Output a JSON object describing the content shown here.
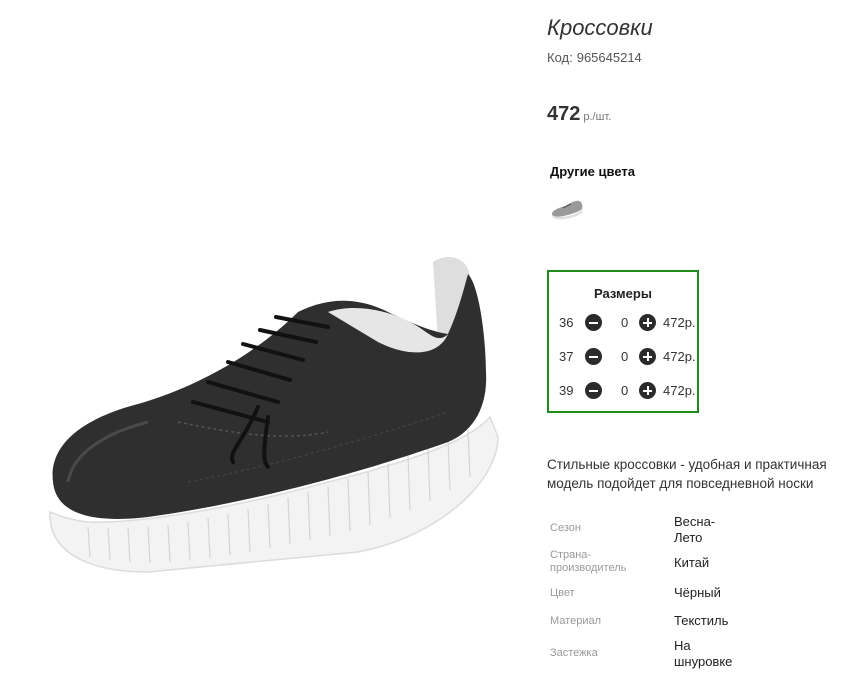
{
  "product": {
    "title": "Кроссовки",
    "code_label": "Код:",
    "code_value": "965645214",
    "price_value": "472",
    "price_unit": "р./шт."
  },
  "other_colors": {
    "title": "Другие цвета",
    "thumbnails": [
      {
        "icon": "sneaker-grey-thumbnail"
      }
    ]
  },
  "sizes": {
    "title": "Размеры",
    "rows": [
      {
        "size": "36",
        "qty": "0",
        "price": "472р."
      },
      {
        "size": "37",
        "qty": "0",
        "price": "472р."
      },
      {
        "size": "39",
        "qty": "0",
        "price": "472р."
      }
    ]
  },
  "description": "Стильные кроссовки - удобная и практичная модель подойдет для повседневной носки",
  "properties": [
    {
      "label": "Сезон",
      "value": "Весна-\nЛето"
    },
    {
      "label": "Страна-\nпроизводитель",
      "value": "Китай"
    },
    {
      "label": "Цвет",
      "value": "Чёрный"
    },
    {
      "label": "Материал",
      "value": "Текстиль"
    },
    {
      "label": "Застежка",
      "value": "На\nшнуровке"
    }
  ],
  "colors": {
    "accent_border": "#1e8a1e",
    "button": "#2b2b2b",
    "shoe_body": "#2f2f2f",
    "sole": "#f4f4f4"
  }
}
